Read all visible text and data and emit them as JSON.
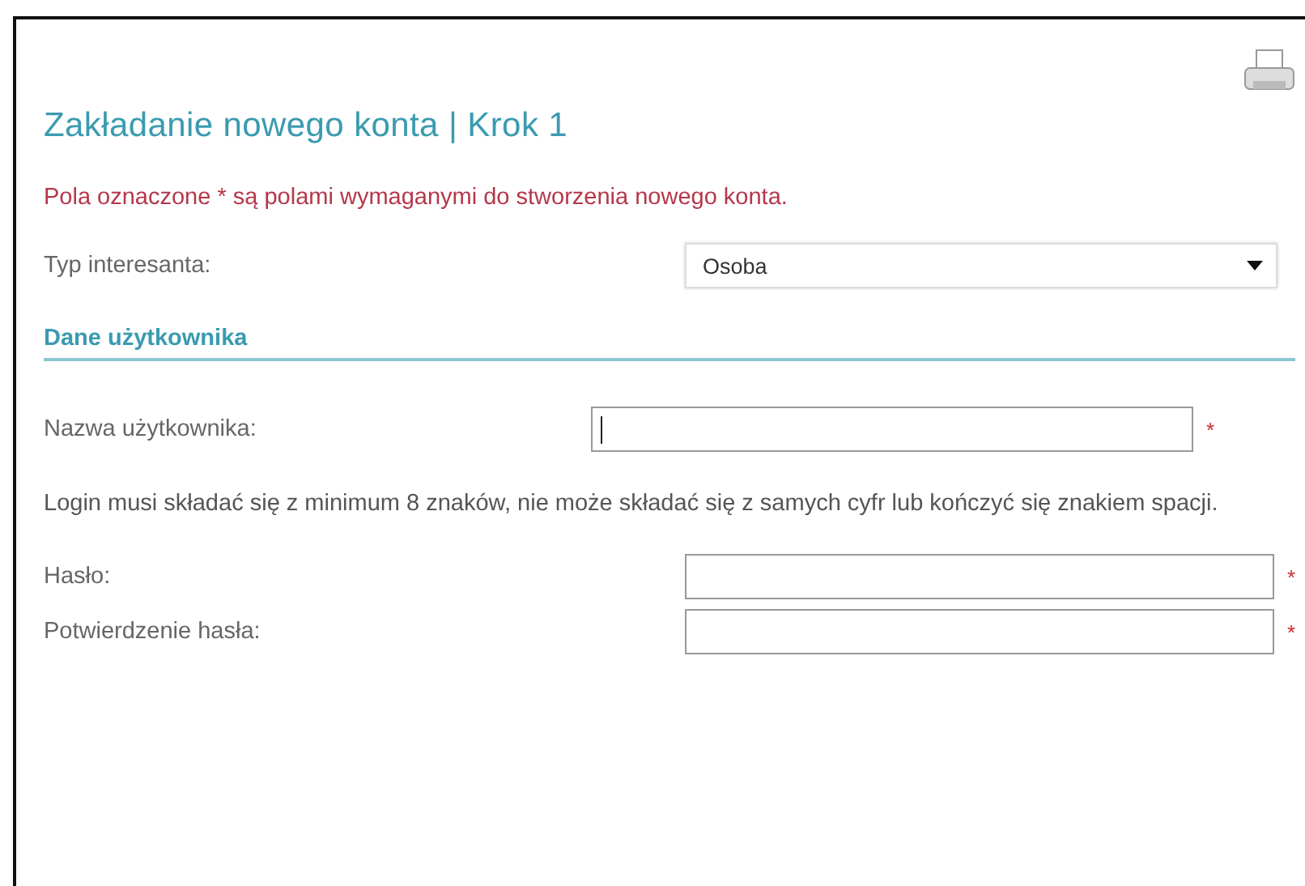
{
  "title": "Zakładanie nowego konta | Krok 1",
  "required_note": "Pola oznaczone * są polami wymaganymi do stworzenia nowego konta.",
  "interest_type": {
    "label": "Typ interesanta:",
    "value": "Osoba"
  },
  "section_title": "Dane użytkownika",
  "username": {
    "label": "Nazwa użytkownika:",
    "required_mark": "*",
    "focused": true
  },
  "login_hint": "Login musi składać się z minimum 8 znaków, nie może składać się z samych cyfr lub kończyć się znakiem spacji.",
  "password_fields": [
    {
      "label": "Hasło:",
      "required_mark": "*"
    },
    {
      "label": "Potwierdzenie hasła:",
      "required_mark": "*"
    }
  ]
}
